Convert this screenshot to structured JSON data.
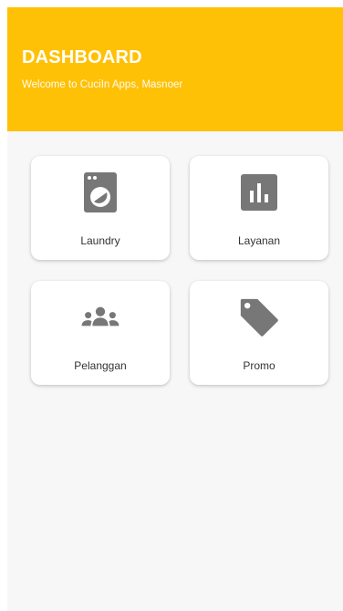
{
  "header": {
    "title": "DASHBOARD",
    "subtitle": "Welcome to CuciIn Apps, Masnoer"
  },
  "menu": [
    {
      "label": "Laundry",
      "icon": "washing-machine-icon"
    },
    {
      "label": "Layanan",
      "icon": "bar-chart-icon"
    },
    {
      "label": "Pelanggan",
      "icon": "group-people-icon"
    },
    {
      "label": "Promo",
      "icon": "tag-icon"
    }
  ],
  "colors": {
    "header_bg": "#ffc105",
    "page_bg": "#f7f7f7",
    "card_bg": "#ffffff",
    "icon": "#777777"
  }
}
